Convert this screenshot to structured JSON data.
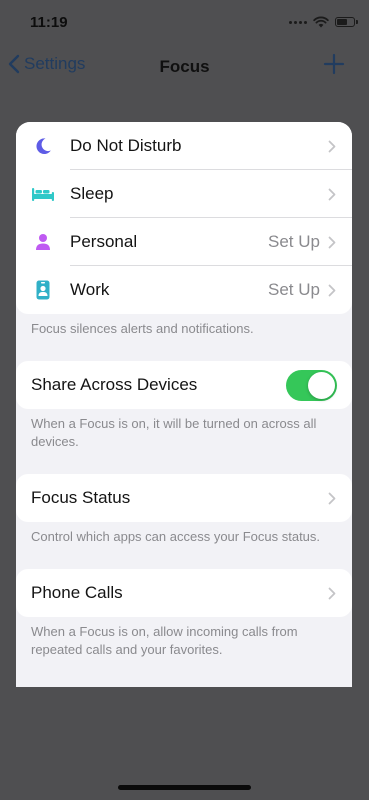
{
  "status_bar": {
    "time": "11:19"
  },
  "nav": {
    "back_label": "Settings",
    "title": "Focus"
  },
  "focus_modes": [
    {
      "label": "Do Not Disturb",
      "value": "",
      "icon": "moon-icon",
      "color": "#5e5ce6"
    },
    {
      "label": "Sleep",
      "value": "",
      "icon": "bed-icon",
      "color": "#2fc8c8"
    },
    {
      "label": "Personal",
      "value": "Set Up",
      "icon": "person-icon",
      "color": "#bf5af2"
    },
    {
      "label": "Work",
      "value": "Set Up",
      "icon": "id-badge-icon",
      "color": "#30b0c7"
    }
  ],
  "focus_footer": "Focus silences alerts and notifications.",
  "share_across_devices": {
    "label": "Share Across Devices",
    "enabled": true,
    "footer": "When a Focus is on, it will be turned on across all devices."
  },
  "focus_status": {
    "label": "Focus Status",
    "footer": "Control which apps can access your Focus status."
  },
  "phone_calls": {
    "label": "Phone Calls",
    "footer": "When a Focus is on, allow incoming calls from repeated calls and your favorites."
  },
  "colors": {
    "toggle_on": "#35c759",
    "background_dim": "#4f4f51",
    "sheet_background": "#f2f2f6",
    "secondary_text": "#8a8a8e"
  }
}
